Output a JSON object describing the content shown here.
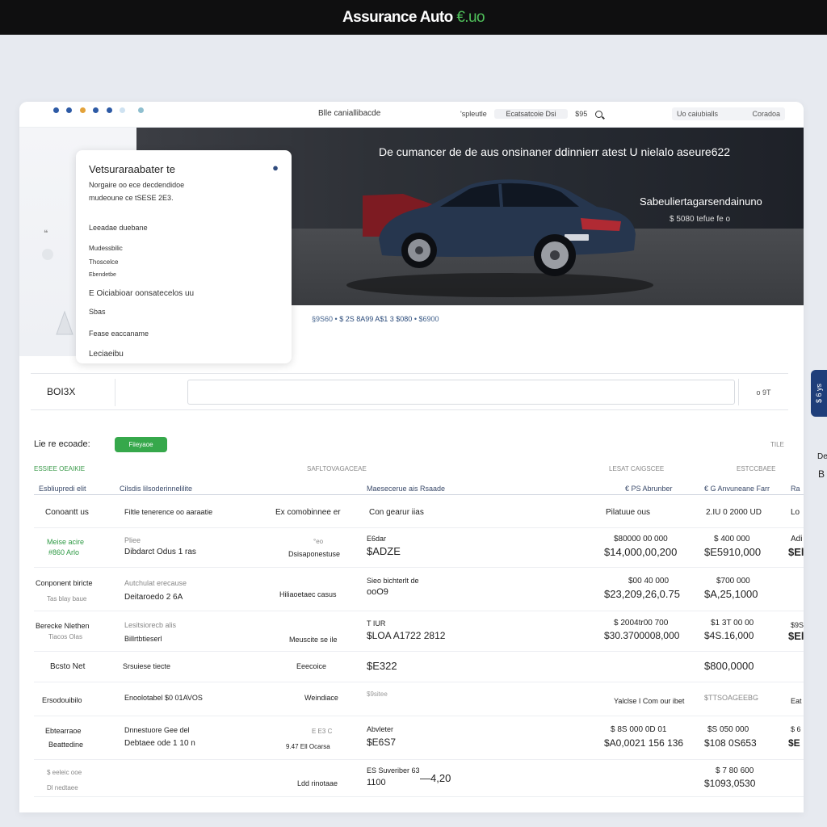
{
  "brand": {
    "name": "Assurance Auto",
    "suffix": "€.uo"
  },
  "chrome": {
    "title": "Blle caniallibacde",
    "search_prefix": "'spleutle",
    "search_pill": "Ecatsatcoie Dsi",
    "search_count": "$95",
    "right_left": "Uo caiubialls",
    "right_right": "Coradoa"
  },
  "hero": {
    "title": "De cumancer de de aus onsinaner ddinnierr atest U nielalo aseure622",
    "subtitle": "Sabeuliertagarsendainuno",
    "subtitle2": "$ 5080 tefue fe o",
    "caption_left": "§9S60 •",
    "caption_mid": "$ 2S 8A99 A$1 3 $080",
    "caption_right": "• $6900"
  },
  "card": {
    "title": "Vetsuraraabater te",
    "line1": "Norgaire oo ece decdendidoe",
    "line2": "mudeoune ce tSESE 2E3.",
    "line3": "Leeadae duebane",
    "line4": "Mudessbilic",
    "line5": "Thoscelce",
    "line6": "Ebendetbe",
    "line7": "E Oiciabioar oonsatecelos uu",
    "line8": "Sbas",
    "line9": "Fease eaccaname",
    "line10": "Leciaeibu"
  },
  "filter": {
    "label": "BOI3X",
    "button": "o 9T"
  },
  "section": {
    "heading": "Lie re ecoade:",
    "button": "Fiieyaoe",
    "tiny_right": "TILE",
    "sub1": "ESSIEE OEAIKIE",
    "sub2": "SAFLTOVAGACEAE",
    "sub3": "LESAT CAIGSCEE",
    "sub4": "ESTCCBAEE"
  },
  "table": {
    "headers": [
      "Esbliupredi elit",
      "Cilsdis lilsoderinnelilite",
      "Maesecerue ais Rsaade",
      "€ PS Abrunber",
      "€ G Anvuneane Farr",
      "Ra"
    ],
    "subheaders": [
      "Conoantt us",
      "Filtle tenerence oo aaraatie",
      "Ex comobinnee er",
      "Con gearur iias",
      "Pilatuue ous",
      "2.IU 0 2000 UD",
      "Lo"
    ],
    "rows": [
      {
        "a1": "Meise acire",
        "a2": "#860 Arlo",
        "b1": "Pliee",
        "b2": "Dibdarct Odus 1 ras",
        "c1": "°eo",
        "c2": "Dsisaponestuse",
        "d1": "E6dar",
        "d2": "$ADZE",
        "e1": "$80000 00 000",
        "e2": "$14,000,00,200",
        "f1": "$ 400 000",
        "f2": "$E5910,000",
        "g1": "Adi",
        "g2": "$El"
      },
      {
        "a1": "Conponent biricte",
        "a2": "Tas blay baue",
        "b1": "Autchulat erecause",
        "b2": "Deitaroedo 2 6A",
        "c1": "",
        "c2": "Hiliaoetaec casus",
        "d1": "Sieo bichterlt de",
        "d2": "ooO9",
        "e1": "$00 40 000",
        "e2": "$23,209,26,0.75",
        "f1": "$700 000",
        "f2": "$A,25,1000",
        "g1": "",
        "g2": ""
      },
      {
        "a1": "Berecke Nlethen",
        "a2": "Tiacos Olas",
        "b1": "Lesitsiorecb alis",
        "b2": "Billrtbtieserl",
        "c1": "",
        "c2": "Meuscite se ile",
        "d1": "T IUR",
        "d2": "$LOA A1722 2812",
        "e1": "$ 2004tr00 700",
        "e2": "$30.3700008,000",
        "f1": "$1 3T 00 00",
        "f2": "$4S.16,000",
        "g1": "$9S",
        "g2": "$El"
      },
      {
        "a1": "Bcsto Net",
        "a2": "",
        "b1": "Srsuiese tiecte",
        "b2": "",
        "c1": "Eeecoice",
        "c2": "",
        "d1": "$E322",
        "d2": "",
        "e1": "",
        "e2": "",
        "f1": "$800,0000",
        "f2": "",
        "g1": "",
        "g2": ""
      },
      {
        "a1": "Ersodouibilo",
        "a2": "",
        "b1": "Enoolotabel $0 01AVOS",
        "b2": "",
        "c1": "Weindiace",
        "c2": "",
        "d1": "$9sitee",
        "d2": "",
        "e1": "Yalclse I Com our ibet",
        "e2": "",
        "f1": "$TTSOAGEEBG",
        "f2": "",
        "g1": "Eat",
        "g2": ""
      },
      {
        "a1": "Ebtearraoe",
        "a2": "Beattedine",
        "b1": "Dnnestuore Gee del",
        "b2": "Debtaee ode 1 10 n",
        "c1": "E E3 C",
        "c2": "9.47 Ell Ocarsa",
        "d1": "Abvleter",
        "d2": "$E6S7",
        "e1": "$ 8S 000 0D  01",
        "e2": "$A0,0021 156 136",
        "f1": "$S 050 000",
        "f2": "$108 0S653",
        "g1": "$ 6",
        "g2": "$E"
      },
      {
        "a1": "$ eeleic ooe",
        "a2": "Dl nedtaee",
        "b1": "",
        "b2": "",
        "c1": "",
        "c2": "Ldd rinotaae",
        "d1": "ES Suveriber 63",
        "d2": "1100",
        "e1": "—4,20",
        "e2": "",
        "f1": "$ 7 80 600",
        "f2": "$1093,0530",
        "g1": "",
        "g2": ""
      }
    ]
  },
  "side_tab": {
    "label": "$ 6 ys"
  },
  "outside": {
    "line1": "De",
    "line2": "B"
  },
  "colors": {
    "accent_green": "#36a84b",
    "navy": "#1f3e7a",
    "car_body": "#26364e",
    "topbar": "#0f0f10"
  }
}
